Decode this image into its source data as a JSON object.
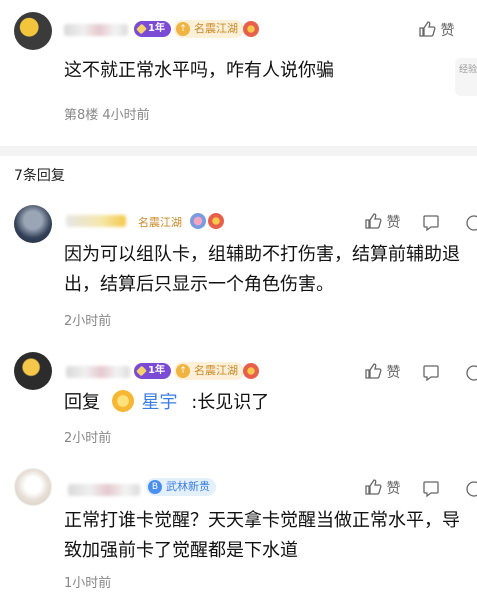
{
  "top_comment": {
    "level": "1年",
    "title": "名震江湖",
    "like_label": "赞",
    "text": "这不就正常水平吗，咋有人说你骗",
    "meta": "第8楼  4小时前",
    "side_pill": "经验 宝"
  },
  "reply_count": "7条回复",
  "replies": [
    {
      "title": "名震江湖",
      "like_label": "赞",
      "text": "因为可以组队卡，组辅助不打伤害，结算前辅助退出，结算后只显示一个角色伤害。",
      "time": "2小时前"
    },
    {
      "level": "1年",
      "title": "名震江湖",
      "like_label": "赞",
      "text_prefix": "回复",
      "mention": "星宇",
      "text_suffix": ":长见识了",
      "time": "2小时前"
    },
    {
      "title": "武林新贵",
      "like_label": "赞",
      "text": "正常打谁卡觉醒？天天拿卡觉醒当做正常水平，导致加强前卡了觉醒都是下水道",
      "time": "1小时前"
    }
  ],
  "colors": {
    "accent": "#3b7ee0",
    "level": "#7b4bd6",
    "title": "#c98a2a"
  }
}
